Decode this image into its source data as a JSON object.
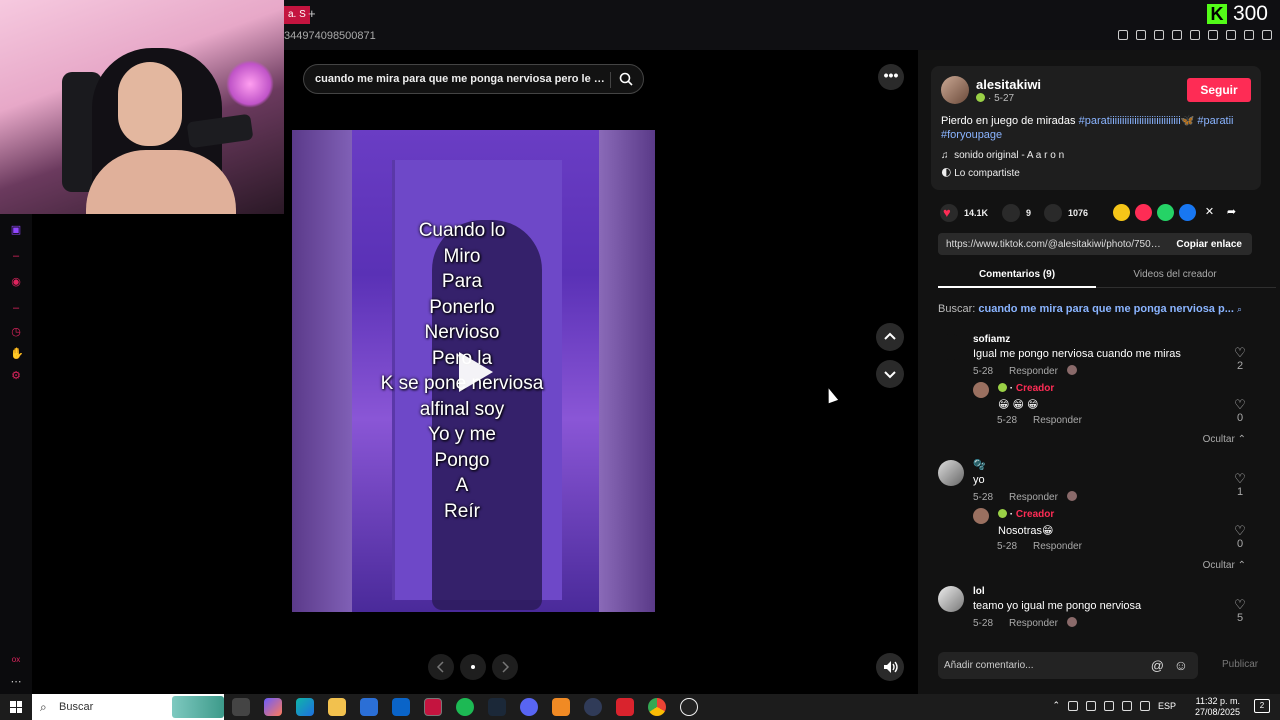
{
  "browser": {
    "tab_label": "a. S",
    "tab_plus": "+",
    "url_fragment": "344974098500871",
    "kick_count": "300",
    "kick_logo": "K"
  },
  "video": {
    "search_query": "cuando me mira para que me ponga nerviosa pero le ma...",
    "more_label": "•••",
    "caption": "Cuando lo\nMiro\nPara\nPonerlo\nNervioso\nPero la\nK se pone nerviosa\nalfinal soy\nYo y me\nPongo\nA\nReír",
    "icons": {
      "search": "search-icon",
      "up": "chevron-up-icon",
      "down": "chevron-down-icon",
      "prev": "chevron-left-icon",
      "next": "chevron-right-icon",
      "volume": "volume-icon",
      "play": "play-icon"
    }
  },
  "post": {
    "username": "alesitakiwi",
    "date": "· 5-27",
    "follow_label": "Seguir",
    "description_plain": "Pierdo en juego de miradas ",
    "hashtag1": "#paratiiiiiiiiiiiiiiiiiiiiiiiiiiiii",
    "butterfly": "🦋",
    "hashtag2": "#paratii",
    "hashtag3": "#foryoupage",
    "sound": "sonido original - A a r o n",
    "shared": "Lo compartiste",
    "likes": "14.1K",
    "comments_count": "9",
    "saves": "1076",
    "link_url": "https://www.tiktok.com/@alesitakiwi/photo/7509...",
    "copy_label": "Copiar enlace",
    "tab_comments": "Comentarios (9)",
    "tab_videos": "Videos del creador",
    "search_prefix": "Buscar: ",
    "search_query": "cuando me mira para que me ponga nerviosa p..."
  },
  "comments": [
    {
      "name": "sofiamz",
      "text": "Igual me pongo nerviosa cuando me miras",
      "date": "5-28",
      "reply_label": "Responder",
      "likes": "2",
      "reply": {
        "creator_label": "Creador",
        "text": "😁 😁 😁",
        "date": "5-28",
        "reply_label": "Responder",
        "likes": "0"
      },
      "hide_label": "Ocultar"
    },
    {
      "name": "🫧",
      "text": "yo",
      "date": "5-28",
      "reply_label": "Responder",
      "likes": "1",
      "reply": {
        "creator_label": "Creador",
        "text": "Nosotras😁",
        "date": "5-28",
        "reply_label": "Responder",
        "likes": "0"
      },
      "hide_label": "Ocultar"
    },
    {
      "name": "lol",
      "text": "teamo yo igual me pongo nerviosa",
      "date": "5-28",
      "reply_label": "Responder",
      "likes": "5"
    }
  ],
  "composer": {
    "placeholder": "Añadir comentario...",
    "at": "@",
    "emoji": "☺",
    "publish_label": "Publicar"
  },
  "taskbar": {
    "search_label": "Buscar",
    "lang": "ESP",
    "time": "11:32 p. m.",
    "date": "27/08/2025",
    "notifications": "2"
  },
  "colors": {
    "accent": "#fe2c55",
    "kick": "#53fc18",
    "hashtag": "#8ab4ff"
  }
}
